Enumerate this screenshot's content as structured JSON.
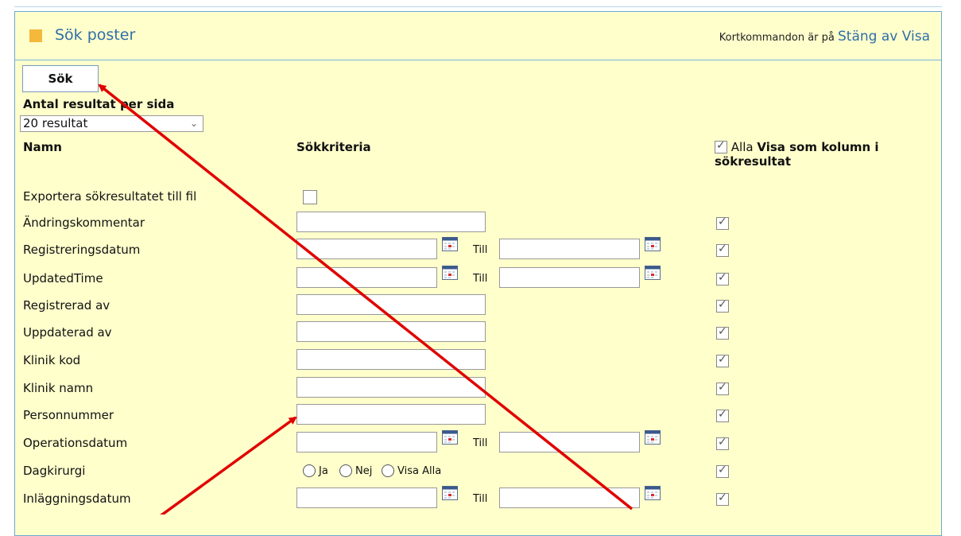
{
  "header": {
    "title": "Sök poster",
    "shortcuts_prefix": "Kortkommandon är på",
    "shortcuts_link": "Stäng av Visa"
  },
  "toolbar": {
    "search_label": "Sök"
  },
  "results_per_page": {
    "label": "Antal resultat per sida",
    "selected": "20 resultat"
  },
  "columns": {
    "name": "Namn",
    "criteria": "Sökkriteria",
    "all_label": "Alla",
    "show_column": "Visa som kolumn i sökresultat"
  },
  "range_separator": "Till",
  "rows": [
    {
      "label": "Exportera sökresultatet till fil"
    },
    {
      "label": "Ändringskommentar"
    },
    {
      "label": "Registreringsdatum"
    },
    {
      "label": "UpdatedTime"
    },
    {
      "label": "Registrerad av"
    },
    {
      "label": "Uppdaterad av"
    },
    {
      "label": "Klinik kod"
    },
    {
      "label": "Klinik namn"
    },
    {
      "label": "Personnummer"
    },
    {
      "label": "Operationsdatum"
    },
    {
      "label": "Dagkirurgi"
    },
    {
      "label": "Inläggningsdatum"
    }
  ],
  "radio_options": [
    "Ja",
    "Nej",
    "Visa Alla"
  ],
  "colors": {
    "accent": "#2f6ea8",
    "panel_bg": "#ffffcc",
    "arrow": "#e00000"
  }
}
